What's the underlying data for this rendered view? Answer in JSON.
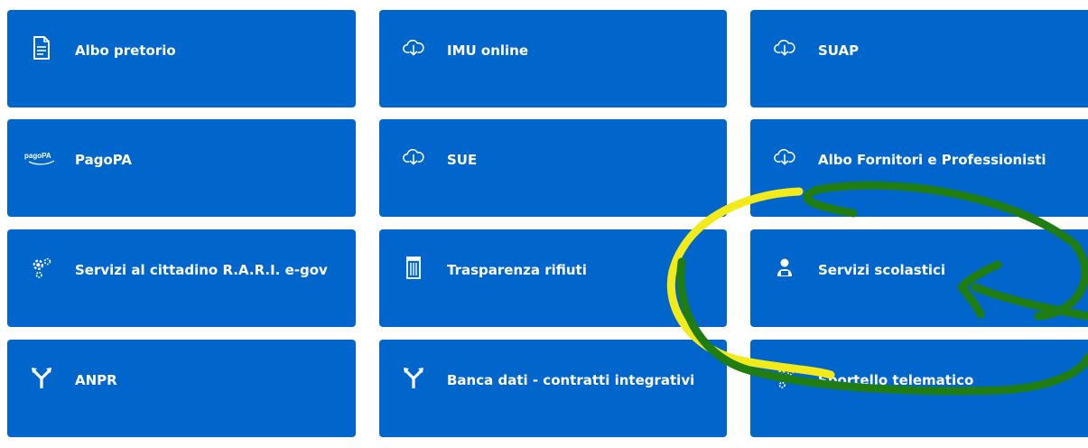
{
  "tiles": [
    {
      "label": "Albo pretorio",
      "icon": "document-icon"
    },
    {
      "label": "IMU online",
      "icon": "cloud-download-icon"
    },
    {
      "label": "SUAP",
      "icon": "cloud-download-icon"
    },
    {
      "label": "PagoPA",
      "icon": "pagopa-icon",
      "icon_text": "pagoPA"
    },
    {
      "label": "SUE",
      "icon": "cloud-download-icon"
    },
    {
      "label": "Albo Fornitori e Professionisti",
      "icon": "cloud-download-icon"
    },
    {
      "label": "Servizi al cittadino R.A.R.I. e-gov",
      "icon": "gears-icon"
    },
    {
      "label": "Trasparenza rifiuti",
      "icon": "trash-bin-icon"
    },
    {
      "label": "Servizi scolastici",
      "icon": "student-icon"
    },
    {
      "label": "ANPR",
      "icon": "fork-arrows-icon"
    },
    {
      "label": "Banca dati - contratti integrativi",
      "icon": "fork-arrows-icon"
    },
    {
      "label": "Sportello telematico",
      "icon": "gears-icon"
    }
  ],
  "colors": {
    "tile_background": "#0066cc",
    "tile_text": "#ffffff",
    "annotation_yellow": "#f2ea19",
    "annotation_green": "#1f7d12"
  }
}
